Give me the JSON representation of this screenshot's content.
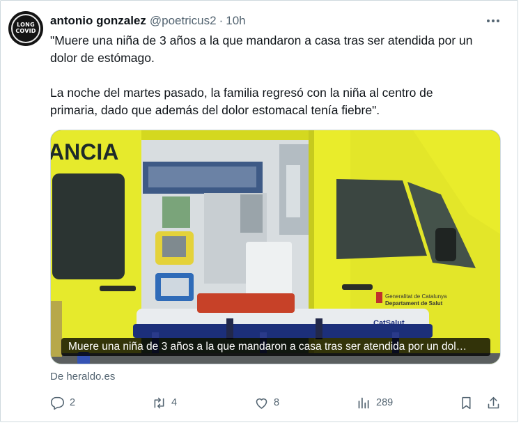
{
  "author": {
    "display_name": "antonio gonzalez",
    "handle": "@poetricus2",
    "separator": "·",
    "time": "10h",
    "avatar_text_line1": "LONG",
    "avatar_text_line2": "COVID",
    "avatar_icon": "long-covid-badge-icon"
  },
  "tweet": {
    "lines": [
      "\"Muere una niña de 3 años a la que mandaron a casa tras ser atendida por un",
      "dolor de estómago.",
      "La noche del martes pasado, la familia regresó con la niña al centro de",
      "primaria, dado que además del dolor estomacal tenía fiebre\"."
    ]
  },
  "media": {
    "caption": "Muere una niña de 3 años a la que mandaron a casa tras ser atendida por un dol…",
    "ambulance_sign": "ANCIA",
    "door_text_line1": "Generalitat de Catalunya",
    "door_text_line2": "Departament de Salut",
    "stretcher_text": "CatSalut"
  },
  "link_source": "De heraldo.es",
  "actions": {
    "reply": {
      "icon": "reply-icon",
      "count": "2"
    },
    "retweet": {
      "icon": "retweet-icon",
      "count": "4"
    },
    "like": {
      "icon": "heart-icon",
      "count": "8"
    },
    "views": {
      "icon": "views-chart-icon",
      "count": "289"
    },
    "bookmark": {
      "icon": "bookmark-icon"
    },
    "share": {
      "icon": "share-icon"
    }
  },
  "colors": {
    "text_primary": "#0f1419",
    "text_secondary": "#536471",
    "border": "#cfd9de",
    "ambulance_yellow": "#e9ec2b"
  }
}
